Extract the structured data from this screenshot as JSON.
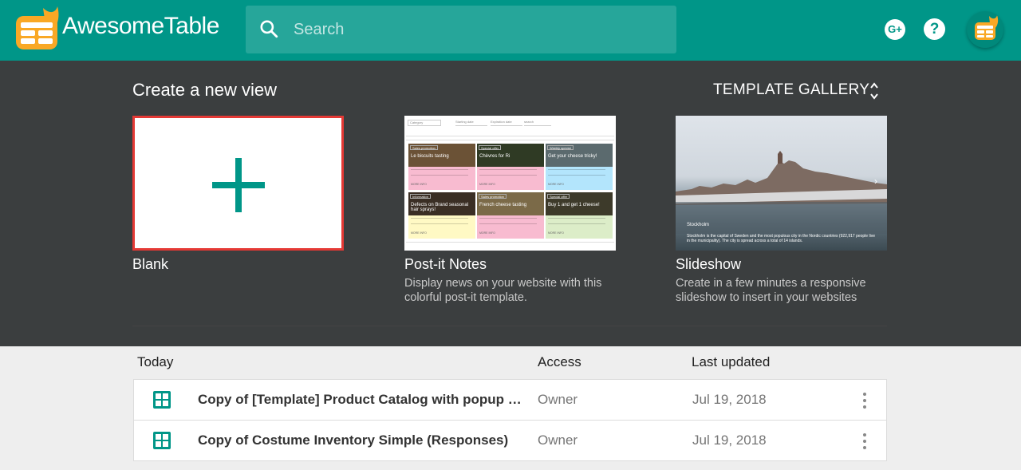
{
  "header": {
    "brand": "AwesomeTable",
    "search_placeholder": "Search",
    "gplus_label": "G+",
    "help_label": "?"
  },
  "create": {
    "title": "Create a new view",
    "gallery_label": "TEMPLATE GALLERY",
    "templates": [
      {
        "name": "Blank",
        "description": ""
      },
      {
        "name": "Post-it Notes",
        "description": "Display news on your website with this colorful post-it template."
      },
      {
        "name": "Slideshow",
        "description": "Create in a few minutes a responsive slideshow to insert in your websites"
      }
    ],
    "postit_preview": {
      "filter_category": "Category",
      "filter_start": "Starting date",
      "filter_expiration": "Expiration date",
      "filter_search": "search",
      "notes": [
        {
          "tag": "Sales promotion",
          "title": "Le biscuits tasting",
          "color": "#f8bbd0"
        },
        {
          "tag": "Special offer",
          "title": "Chèvres for Ri",
          "color": "#f8bbd0"
        },
        {
          "tag": "Weekly special",
          "title": "Get your cheese tricky!",
          "color": "#b3e5fc"
        },
        {
          "tag": "Information",
          "title": "Defects on Brand seasonal hair sprays!",
          "color": "#fff9c4"
        },
        {
          "tag": "Sales promotion",
          "title": "French cheese tasting",
          "color": "#f8bbd0"
        },
        {
          "tag": "Special offer",
          "title": "Buy 1 and get 1 cheese!",
          "color": "#dcedc8"
        }
      ]
    },
    "slideshow_preview": {
      "caption": "Stockholm",
      "text": "Stockholm is the capital of Sweden and the most populous city in the Nordic countries (922,917 people live in the municipality). The city is spread across a total of 14 islands."
    }
  },
  "list": {
    "col_name": "Today",
    "col_access": "Access",
    "col_updated": "Last updated",
    "rows": [
      {
        "name": "Copy of [Template] Product Catalog with popup de...",
        "access": "Owner",
        "updated": "Jul 19, 2018"
      },
      {
        "name": "Copy of Costume Inventory Simple (Responses)",
        "access": "Owner",
        "updated": "Jul 19, 2018"
      }
    ]
  },
  "colors": {
    "primary": "#009688",
    "search_bg": "#26a69a",
    "dark_section": "#3b3e3f",
    "blank_border": "#e53935",
    "logo_orange": "#f9a825"
  },
  "icons": [
    "awesometable-logo-icon",
    "search-icon",
    "google-plus-icon",
    "help-icon",
    "sort-arrows-icon",
    "plus-icon",
    "sheet-grid-icon",
    "more-vert-icon"
  ]
}
